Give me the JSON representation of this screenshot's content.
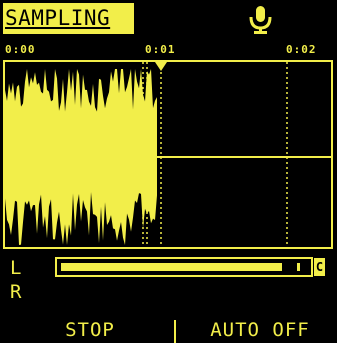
{
  "header": {
    "title": "SAMPLING",
    "icon": "microphone-icon"
  },
  "timeline": {
    "labels": [
      "0:00",
      "0:01",
      "0:02"
    ],
    "playhead_position_seconds": 1.1
  },
  "level_meter": {
    "channels": [
      "L",
      "R"
    ],
    "level_fraction": 0.9,
    "clip_label": "C"
  },
  "softkeys": {
    "left": "STOP",
    "right": "AUTO OFF"
  },
  "colors": {
    "foreground": "#f2ee4a",
    "background": "#000000"
  }
}
